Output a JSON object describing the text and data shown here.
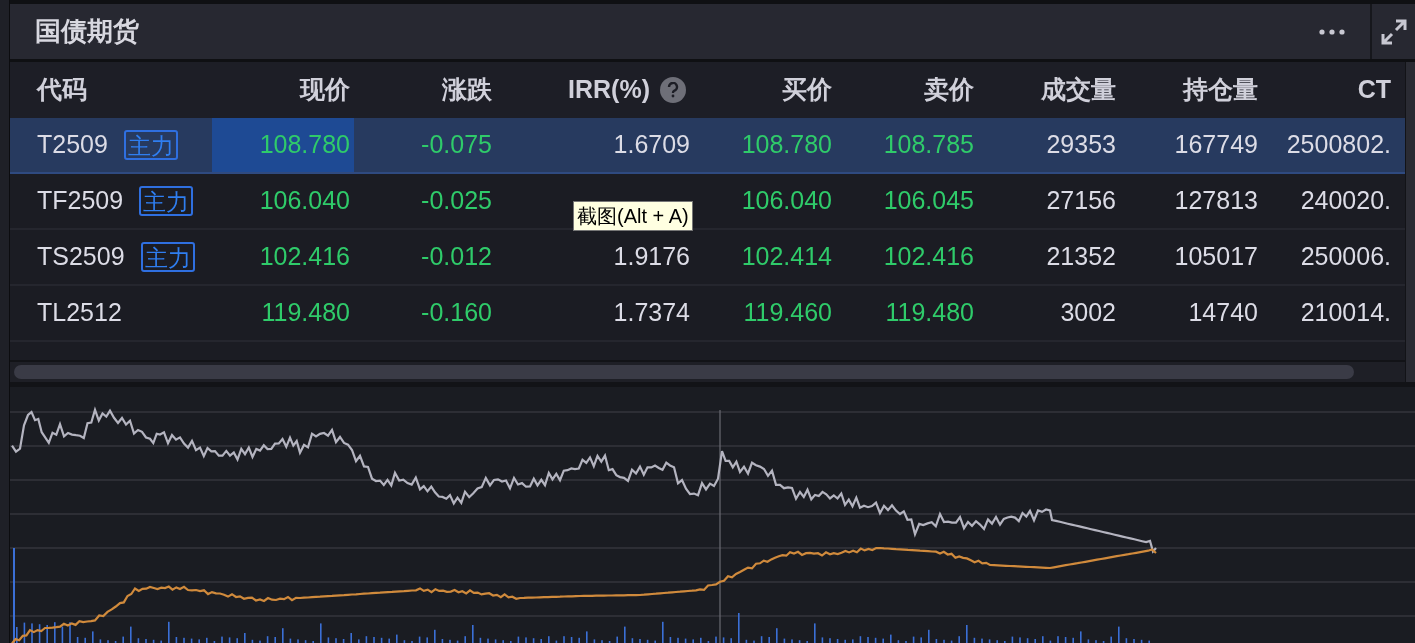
{
  "panel": {
    "title": "国债期货"
  },
  "table": {
    "columns": [
      {
        "label": "代码",
        "kind": "code"
      },
      {
        "label": "现价",
        "kind": "price"
      },
      {
        "label": "涨跌",
        "kind": "price"
      },
      {
        "label": "IRR(%)",
        "kind": "plain",
        "help": true
      },
      {
        "label": "买价",
        "kind": "price"
      },
      {
        "label": "卖价",
        "kind": "price"
      },
      {
        "label": "成交量",
        "kind": "plain"
      },
      {
        "label": "持仓量",
        "kind": "plain"
      },
      {
        "label": "CT",
        "kind": "plain"
      }
    ],
    "rows": [
      {
        "selected": true,
        "flash": true,
        "tag": "主力",
        "cells": [
          "T2509",
          "108.780",
          "-0.075",
          "1.6709",
          "108.780",
          "108.785",
          "29353",
          "167749",
          "2500802."
        ]
      },
      {
        "selected": false,
        "flash": false,
        "tag": "主力",
        "cells": [
          "TF2509",
          "106.040",
          "-0.025",
          null,
          "106.040",
          "106.045",
          "27156",
          "127813",
          "240020."
        ]
      },
      {
        "selected": false,
        "flash": false,
        "tag": "主力",
        "cells": [
          "TS2509",
          "102.416",
          "-0.012",
          "1.9176",
          "102.414",
          "102.416",
          "21352",
          "105017",
          "250006."
        ]
      },
      {
        "selected": false,
        "flash": false,
        "cells": [
          "TL2512",
          "119.480",
          "-0.160",
          "1.7374",
          "119.460",
          "119.480",
          "3002",
          "14740",
          "210014."
        ]
      }
    ]
  },
  "tooltip": {
    "text": "截图(Alt + A)"
  }
}
